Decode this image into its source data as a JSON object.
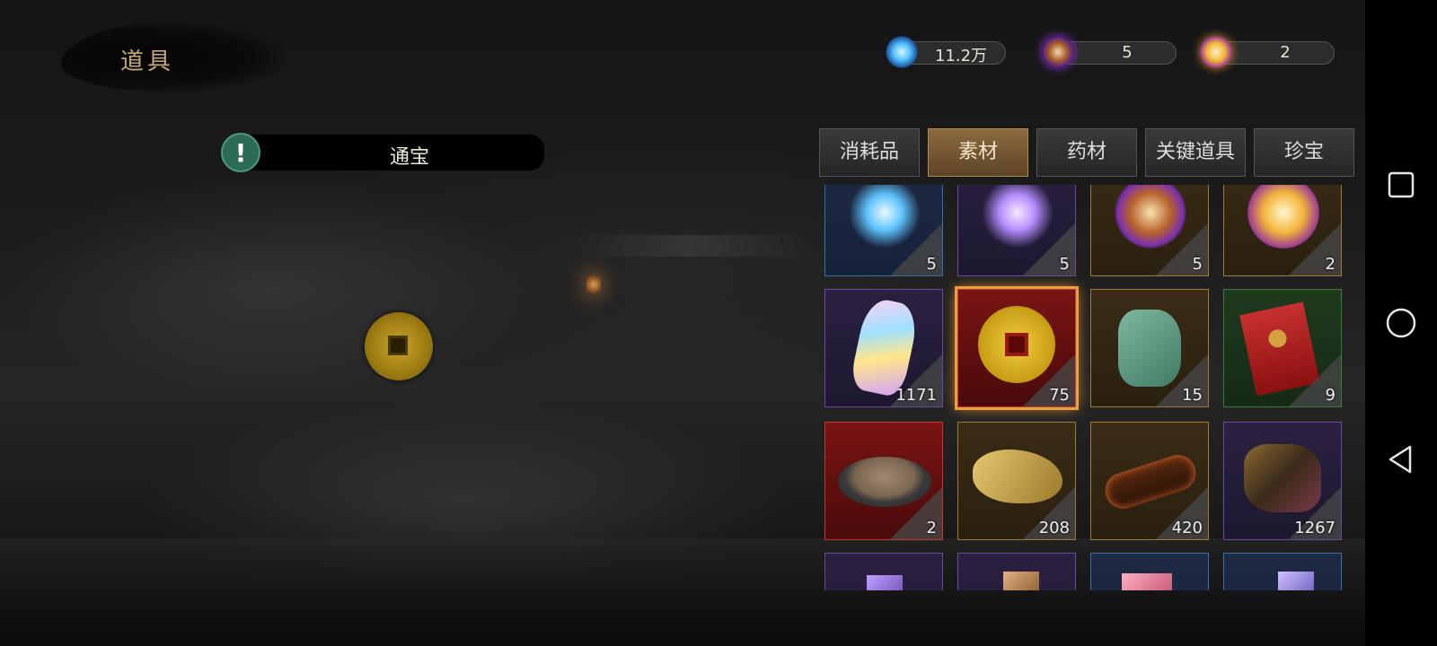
{
  "header": {
    "title": "道具"
  },
  "currencies": [
    {
      "icon": "spirit-crystal-icon",
      "value": "11.2万"
    },
    {
      "icon": "yinyang-orb-icon",
      "value": "5"
    },
    {
      "icon": "sun-orb-icon",
      "value": "2"
    }
  ],
  "selected_item": {
    "name": "通宝"
  },
  "tabs": [
    {
      "label": "消耗品",
      "active": false
    },
    {
      "label": "素材",
      "active": true
    },
    {
      "label": "药材",
      "active": false
    },
    {
      "label": "关键道具",
      "active": false
    },
    {
      "label": "珍宝",
      "active": false
    }
  ],
  "items": [
    {
      "icon": "blue-orb-staff-icon",
      "count": "5",
      "quality": "blue"
    },
    {
      "icon": "purple-orb-staff-icon",
      "count": "5",
      "quality": "purple"
    },
    {
      "icon": "yinyang-orb-icon",
      "count": "5",
      "quality": "gold"
    },
    {
      "icon": "sun-orb-icon",
      "count": "2",
      "quality": "gold"
    },
    {
      "icon": "rainbow-crystal-icon",
      "count": "1171",
      "quality": "purple"
    },
    {
      "icon": "copper-coin-icon",
      "count": "75",
      "quality": "red",
      "selected": true
    },
    {
      "icon": "jade-tablet-icon",
      "count": "15",
      "quality": "gold"
    },
    {
      "icon": "red-envelope-icon",
      "count": "9",
      "quality": "green"
    },
    {
      "icon": "sand-bowl-icon",
      "count": "2",
      "quality": "red"
    },
    {
      "icon": "golden-beast-icon",
      "count": "208",
      "quality": "gold"
    },
    {
      "icon": "burning-log-icon",
      "count": "420",
      "quality": "gold"
    },
    {
      "icon": "mineral-ore-icon",
      "count": "1267",
      "quality": "purple"
    },
    {
      "icon": "purple-gem-icon",
      "count": "",
      "quality": "purple"
    },
    {
      "icon": "amber-shard-icon",
      "count": "",
      "quality": "purple"
    },
    {
      "icon": "pink-crystal-icon",
      "count": "",
      "quality": "blue"
    },
    {
      "icon": "violet-crystal-icon",
      "count": "",
      "quality": "blue"
    }
  ]
}
